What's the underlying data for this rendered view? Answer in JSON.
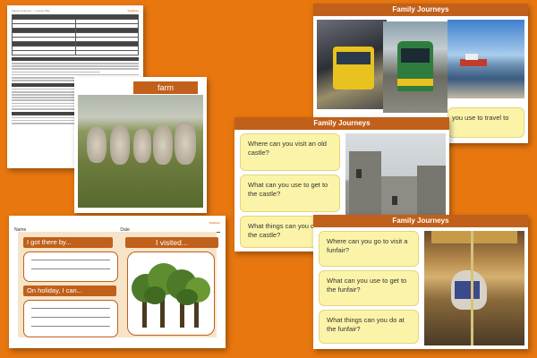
{
  "lesson_plan": {
    "header_left": "Family Journeys — Lesson Plan",
    "brand": "TinyDots"
  },
  "farm_card": {
    "title": "farm"
  },
  "worksheet": {
    "brand": "TinyDots",
    "name_label": "Name",
    "date_label": "Date",
    "got_there_label": "I got there by...",
    "holiday_label": "On holiday, I can...",
    "visited_label": "I visited..."
  },
  "card_transport": {
    "title": "Family Journeys",
    "question_1": "you use to travel to"
  },
  "card_castle": {
    "title": "Family Journeys",
    "question_1": "Where can you visit an old castle?",
    "question_2": "What can you use to get to the castle?",
    "question_3": "What things can you do at the castle?"
  },
  "card_funfair": {
    "title": "Family Journeys",
    "question_1": "Where can you go to visit a funfair?",
    "question_2": "What can you use to get to the funfair?",
    "question_3": "What things can you do at the funfair?"
  },
  "colors": {
    "background": "#e8770f",
    "band": "#c0601a",
    "question_box": "#fbf4a8"
  }
}
